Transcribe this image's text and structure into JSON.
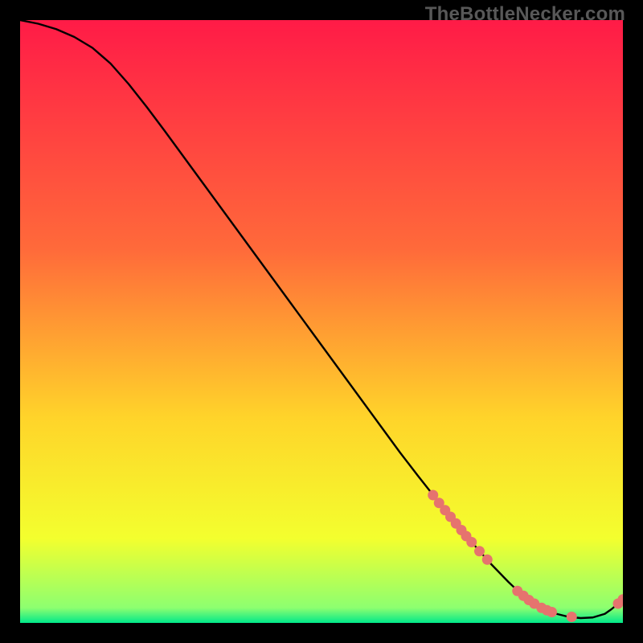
{
  "watermark": "TheBottleNecker.com",
  "colors": {
    "gradient_top": "#ff1b47",
    "gradient_mid1": "#ff6a3a",
    "gradient_mid2": "#ffd42a",
    "gradient_mid3": "#f3ff2e",
    "gradient_bottom": "#00e88a",
    "curve": "#000000",
    "marker": "#e6736e",
    "frame": "#000000"
  },
  "chart_data": {
    "type": "line",
    "title": "",
    "xlabel": "",
    "ylabel": "",
    "xlim": [
      0,
      100
    ],
    "ylim": [
      0,
      100
    ],
    "grid": false,
    "legend": false,
    "series": [
      {
        "name": "bottleneck-curve",
        "x": [
          0,
          3,
          6,
          9,
          12,
          15,
          18,
          21,
          24,
          27,
          30,
          33,
          36,
          39,
          42,
          45,
          48,
          51,
          54,
          57,
          60,
          63,
          66,
          69,
          72,
          75,
          78,
          81,
          83,
          85,
          87,
          89,
          91,
          93,
          95,
          97,
          98,
          99,
          100
        ],
        "values": [
          100,
          99.4,
          98.5,
          97.2,
          95.4,
          92.8,
          89.4,
          85.6,
          81.6,
          77.5,
          73.4,
          69.3,
          65.2,
          61.1,
          57.0,
          52.9,
          48.8,
          44.7,
          40.6,
          36.5,
          32.4,
          28.3,
          24.4,
          20.6,
          16.9,
          13.3,
          9.9,
          6.8,
          4.9,
          3.4,
          2.3,
          1.5,
          1.0,
          0.8,
          0.9,
          1.5,
          2.2,
          3.0,
          3.9
        ]
      }
    ],
    "markers": {
      "name": "highlight-points",
      "x": [
        68.5,
        69.5,
        70.5,
        71.4,
        72.3,
        73.2,
        74.0,
        74.9,
        76.2,
        77.5,
        82.5,
        83.5,
        84.4,
        85.3,
        86.5,
        87.4,
        88.2,
        91.5,
        99.2,
        100.0
      ],
      "values": [
        21.2,
        19.9,
        18.7,
        17.6,
        16.5,
        15.4,
        14.4,
        13.4,
        11.9,
        10.5,
        5.3,
        4.5,
        3.8,
        3.2,
        2.5,
        2.1,
        1.8,
        1.0,
        3.2,
        3.9
      ]
    }
  }
}
